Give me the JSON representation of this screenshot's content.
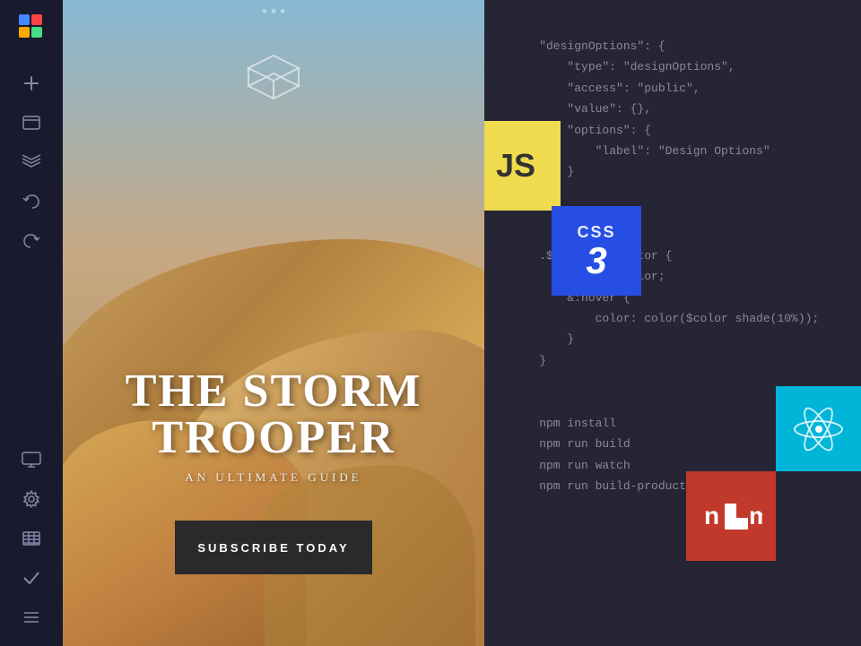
{
  "sidebar": {
    "logo_alt": "App Logo",
    "icons": [
      {
        "name": "add-icon",
        "symbol": "+",
        "interactable": true
      },
      {
        "name": "browser-icon",
        "symbol": "▭",
        "interactable": true
      },
      {
        "name": "layers-icon",
        "symbol": "≡",
        "interactable": true
      },
      {
        "name": "undo-icon",
        "symbol": "↩",
        "interactable": true
      },
      {
        "name": "redo-icon",
        "symbol": "↪",
        "interactable": true
      },
      {
        "name": "monitor-icon",
        "symbol": "⬜",
        "interactable": true
      },
      {
        "name": "settings-icon",
        "symbol": "⚙",
        "interactable": true
      },
      {
        "name": "table-icon",
        "symbol": "⊞",
        "interactable": true
      },
      {
        "name": "check-icon",
        "symbol": "✓",
        "interactable": true
      },
      {
        "name": "menu-icon",
        "symbol": "☰",
        "interactable": true
      }
    ]
  },
  "preview": {
    "headline": "THE STORM\nTROOPER",
    "headline_line1": "THE STORM",
    "headline_line2": "TROOPER",
    "subheadline": "AN ULTIMATE GUIDE",
    "subscribe_button": "SUBSCRIBE TODAY"
  },
  "code": {
    "block1": "\"designOptions\": {\n    \"type\": \"designOptions\",\n    \"access\": \"public\",\n    \"value\": {},\n    \"options\": {\n        \"label\": \"Design Options\"\n    }\n}",
    "block2": ".$color .selector {\n    color: $color;\n    &:hover {\n        color: color($color shade(10%));\n    }\n}",
    "block3": "npm install\nnpm run build\nnpm run watch\nnpm run build-production"
  },
  "badges": {
    "js": "JS",
    "css": "CSS",
    "css_num": "3",
    "react": "React",
    "npm": "npm"
  },
  "colors": {
    "sidebar_bg": "#1a1a2e",
    "preview_sky": "#87b8d4",
    "code_bg": "#252535",
    "js_yellow": "#f0db4f",
    "css_blue": "#264de4",
    "react_teal": "#00b5d8",
    "npm_red": "#c0392b"
  }
}
